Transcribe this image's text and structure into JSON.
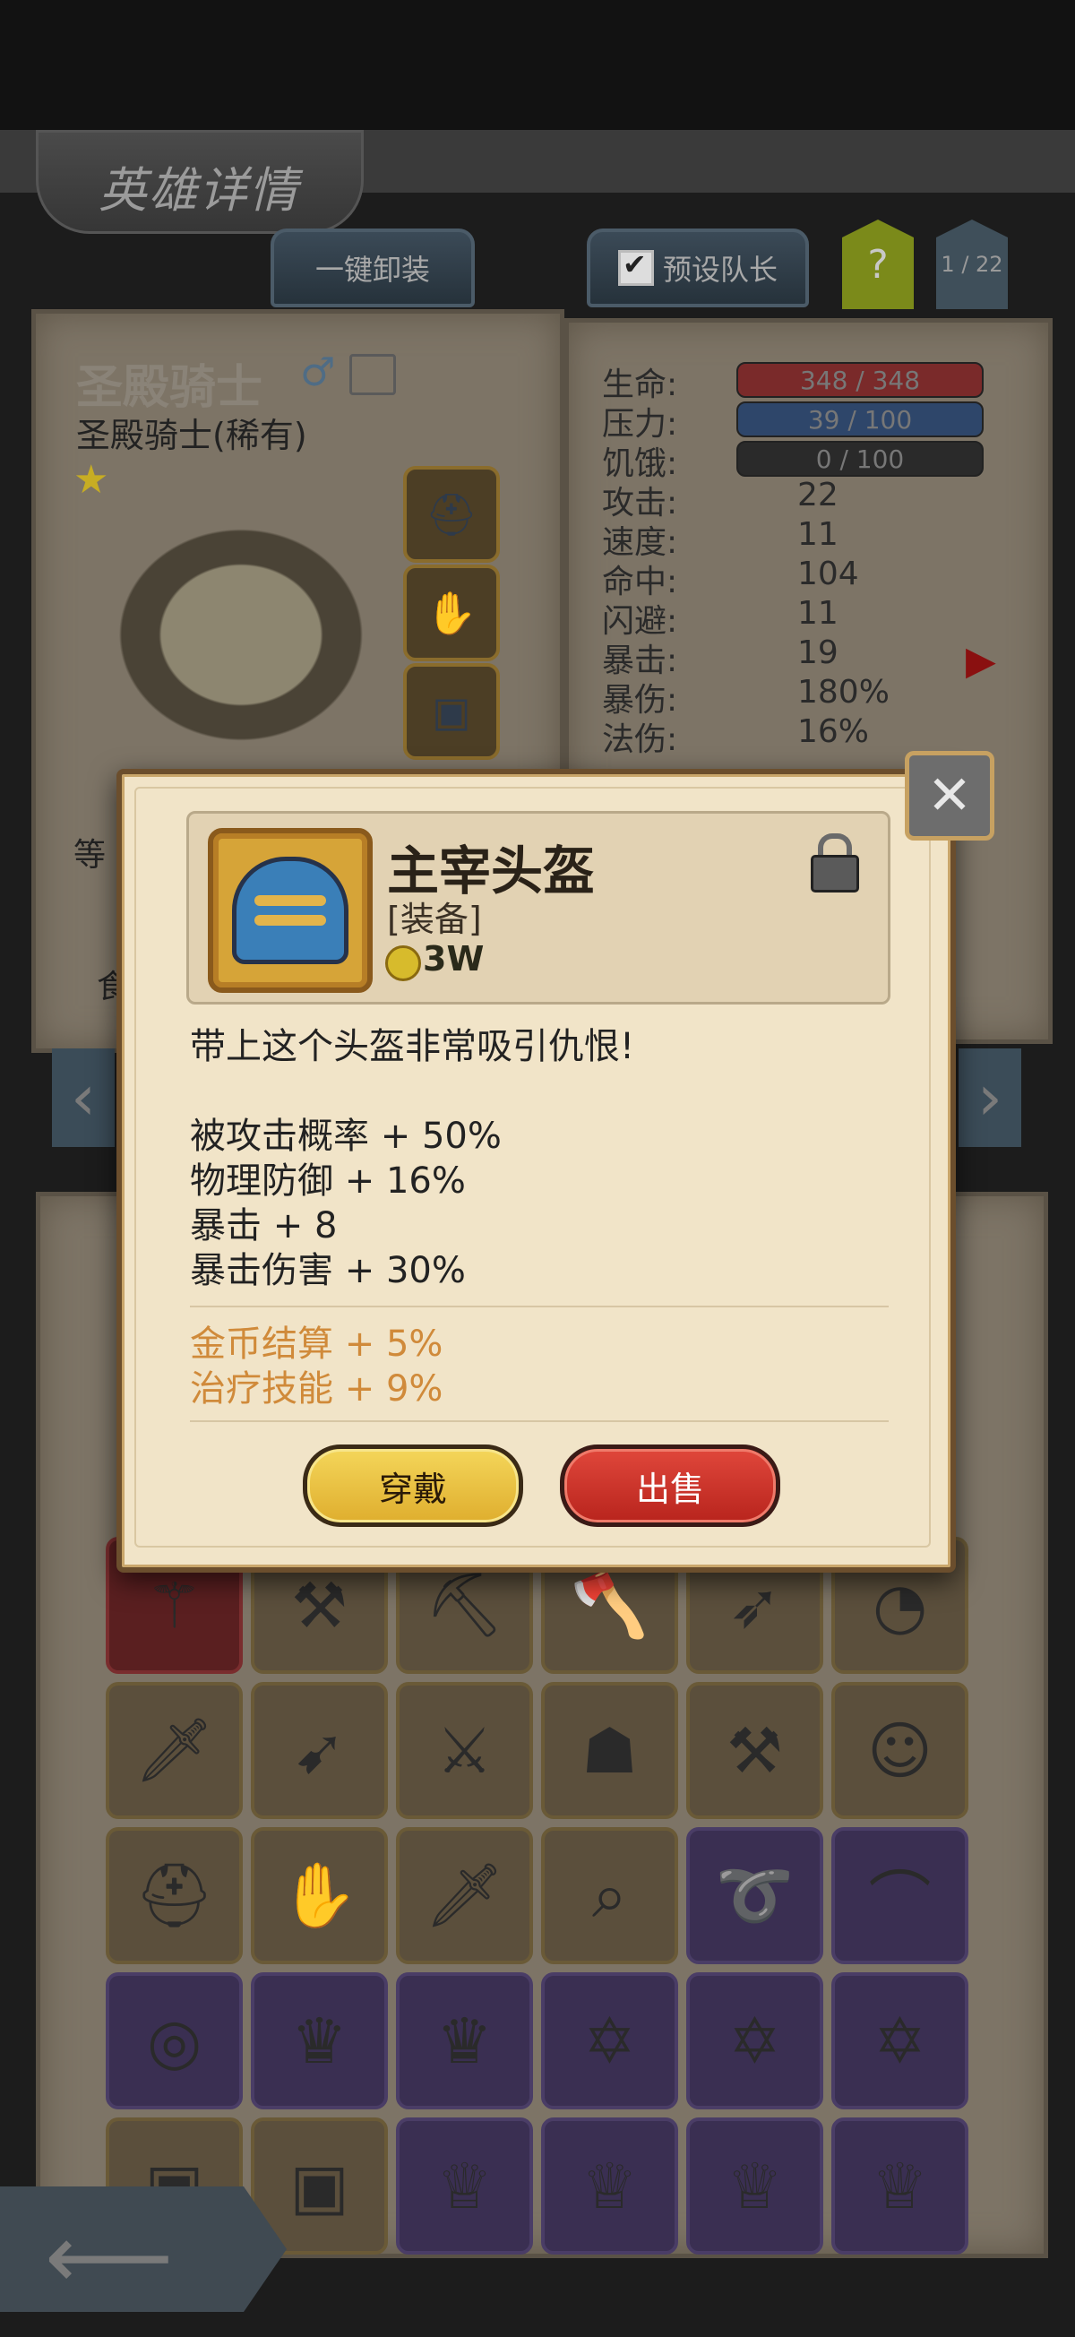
{
  "header": {
    "title": "英雄详情"
  },
  "toolbar": {
    "unload_all": "一键卸装",
    "preset_leader": "预设队长",
    "help": "?",
    "page": "1 / 22"
  },
  "hero": {
    "name": "圣殿骑士",
    "subtitle": "圣殿骑士(稀有)",
    "stars": 1,
    "side_labels": [
      "等",
      "食"
    ]
  },
  "stats": [
    {
      "label": "生命:",
      "value": "348 / 348",
      "kind": "bar",
      "color": "#7a2a2a"
    },
    {
      "label": "压力:",
      "value": "39 / 100",
      "kind": "bar",
      "color": "#2e466a"
    },
    {
      "label": "饥饿:",
      "value": "0 / 100",
      "kind": "bar",
      "color": "#2a2a2a"
    },
    {
      "label": "攻击:",
      "value": "22"
    },
    {
      "label": "速度:",
      "value": "11"
    },
    {
      "label": "命中:",
      "value": "104"
    },
    {
      "label": "闪避:",
      "value": "11"
    },
    {
      "label": "暴击:",
      "value": "19"
    },
    {
      "label": "暴伤:",
      "value": "180%"
    },
    {
      "label": "法伤:",
      "value": "16%"
    }
  ],
  "item_popup": {
    "name": "主宰头盔",
    "type": "[装备]",
    "price": "3W",
    "description": "带上这个头盔非常吸引仇恨!",
    "stats": [
      "被攻击概率 + 50%",
      "物理防御 + 16%",
      "暴击 + 8",
      "暴击伤害 + 30%"
    ],
    "bonuses": [
      "金币结算 + 5%",
      "治疗技能 + 9%"
    ],
    "equip_label": "穿戴",
    "sell_label": "出售",
    "bonus_color": "#d08a3a"
  },
  "inventory_icons": [
    [
      "staff-icon",
      "hammer-icon",
      "pickaxe-icon",
      "axe-icon",
      "crossbow-icon",
      "fan-icon"
    ],
    [
      "sword-icon",
      "drill-lance-icon",
      "long-sword-icon",
      "mask-helmet-icon",
      "battle-axe-icon",
      "doll-icon"
    ],
    [
      "helmet-icon",
      "claw-glove-icon",
      "flame-sword-icon",
      "spyglass-icon",
      "whip-icon",
      "fang-necklace-icon"
    ],
    [
      "belt-icon",
      "crown-icon",
      "crown-icon",
      "star-emblem-icon",
      "star-emblem-icon",
      "star-emblem-icon"
    ],
    [
      "backpack-icon",
      "backpack-icon",
      "wing-crown-icon",
      "wing-crown-icon",
      "wing-crown-icon",
      "wing-crown-icon"
    ]
  ]
}
